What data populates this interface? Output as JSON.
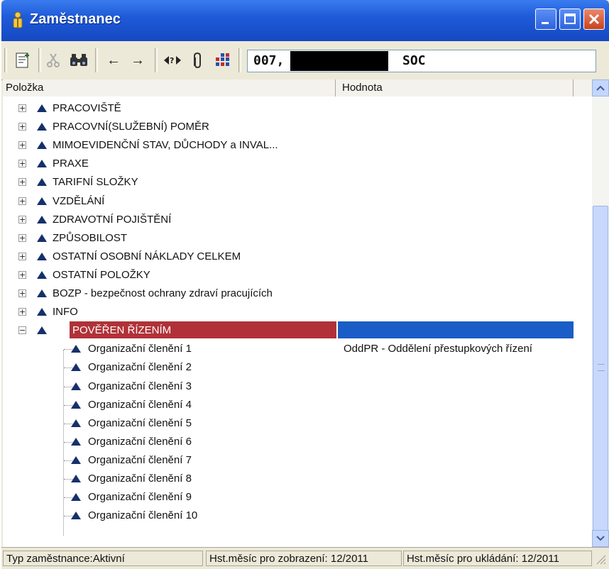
{
  "window": {
    "title": "Zaměstnanec",
    "buttons": [
      "minimize-icon",
      "maximize-icon",
      "close-icon"
    ]
  },
  "toolbar": {
    "icons": [
      "employee-card-icon",
      "scissors-icon",
      "binoculars-icon",
      "arrow-left-icon",
      "arrow-right-icon",
      "arrows-swap-icon",
      "clip-icon",
      "grid-icon"
    ],
    "back_label": "←",
    "forward_label": "→",
    "id_prefix": "007,",
    "id_suffix": "SOC"
  },
  "columns": {
    "name": "Položka",
    "value": "Hodnota"
  },
  "tree": {
    "groups": [
      {
        "label": "PRACOVIŠTĚ",
        "expander": "+"
      },
      {
        "label": "PRACOVNÍ(SLUŽEBNÍ) POMĚR",
        "expander": "+"
      },
      {
        "label": "MIMOEVIDENČNÍ STAV, DŮCHODY a INVAL...",
        "expander": "+"
      },
      {
        "label": "PRAXE",
        "expander": "+"
      },
      {
        "label": "TARIFNÍ SLOŽKY",
        "expander": "+"
      },
      {
        "label": "VZDĚLÁNÍ",
        "expander": "+"
      },
      {
        "label": "ZDRAVOTNÍ POJIŠTĚNÍ",
        "expander": "+"
      },
      {
        "label": "ZPŮSOBILOST",
        "expander": "+"
      },
      {
        "label": "OSTATNÍ OSOBNÍ NÁKLADY CELKEM",
        "expander": "+"
      },
      {
        "label": "OSTATNÍ POLOŽKY",
        "expander": "+"
      },
      {
        "label": "BOZP - bezpečnost ochrany zdraví pracujících",
        "expander": "+"
      },
      {
        "label": "INFO",
        "expander": "+"
      }
    ],
    "selected": {
      "label": "POVĚŘEN ŘÍZENÍM",
      "expander": "−"
    },
    "children": [
      {
        "label": "Organizační členění 1",
        "value": "OddPR - Oddělení přestupkových řízení"
      },
      {
        "label": "Organizační členění 2",
        "value": ""
      },
      {
        "label": "Organizační členění 3",
        "value": ""
      },
      {
        "label": "Organizační členění 4",
        "value": ""
      },
      {
        "label": "Organizační členění 5",
        "value": ""
      },
      {
        "label": "Organizační členění 6",
        "value": ""
      },
      {
        "label": "Organizační členění 7",
        "value": ""
      },
      {
        "label": "Organizační členění 8",
        "value": ""
      },
      {
        "label": "Organizační členění 9",
        "value": ""
      },
      {
        "label": "Organizační členění 10",
        "value": ""
      }
    ]
  },
  "status": {
    "employee_type": "Typ zaměstnance:Aktivní",
    "display_month": "Hst.měsíc pro zobrazení: 12/2011",
    "save_month": "Hst.měsíc pro ukládání: 12/2011"
  },
  "colors": {
    "title_bar": "#1f5bd8",
    "selection_name": "#b03238",
    "selection_value": "#1a5dc6",
    "node_icon": "#16306b"
  }
}
